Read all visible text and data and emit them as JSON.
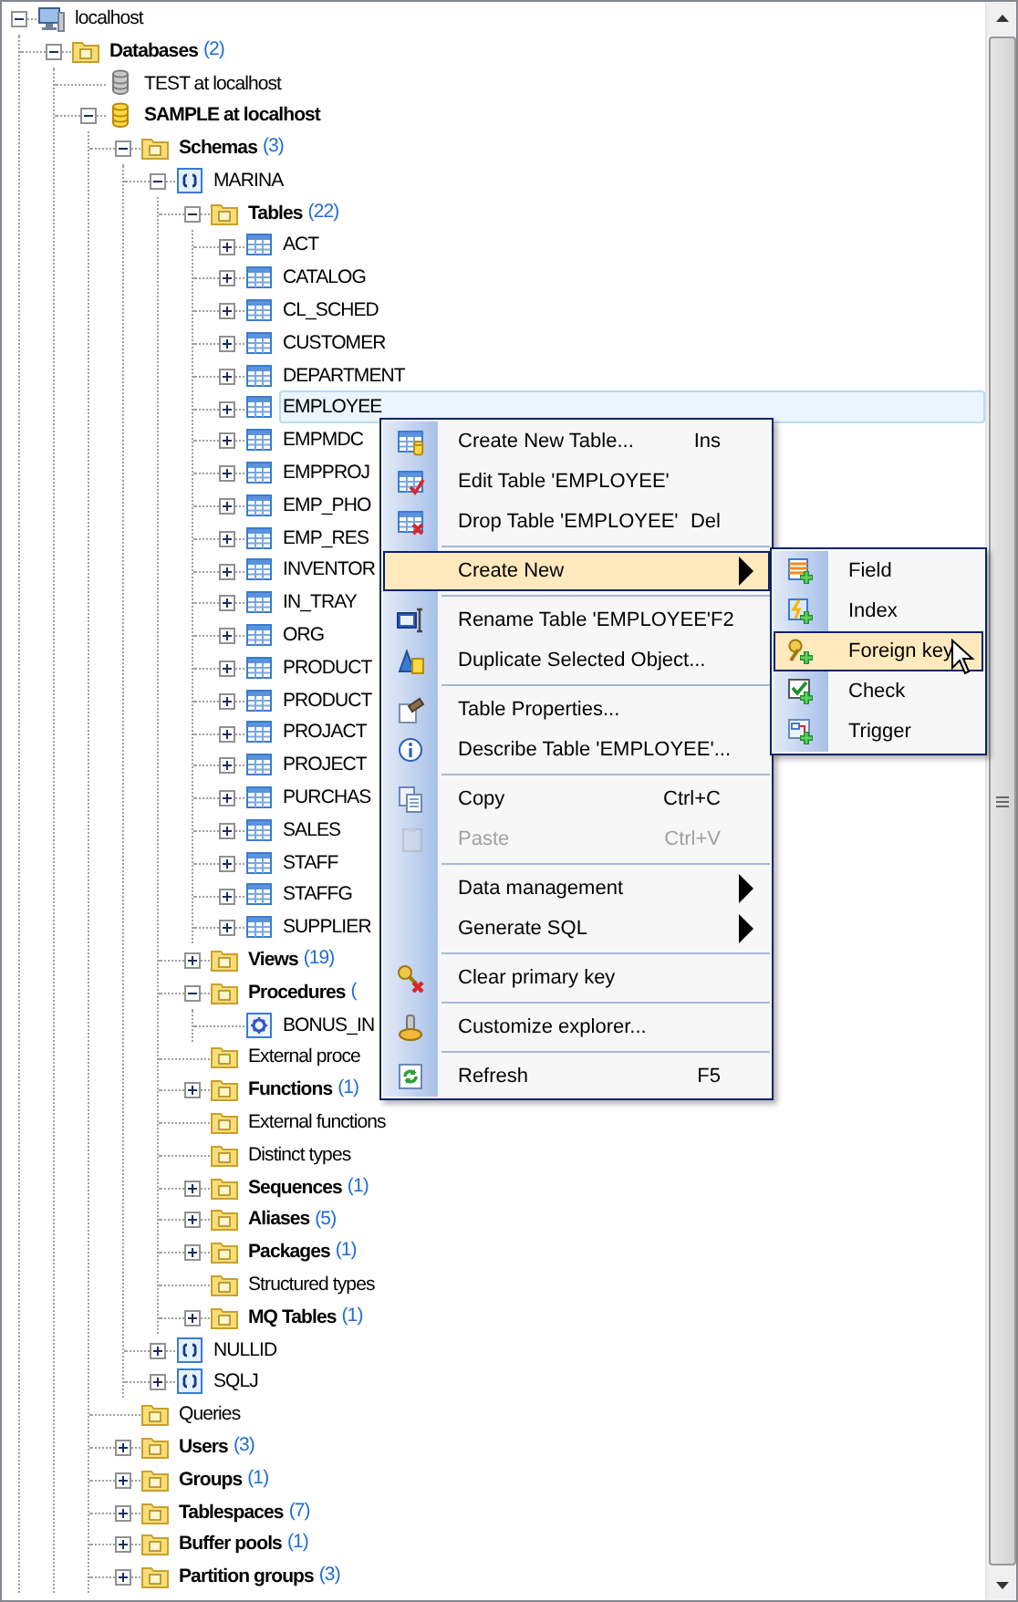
{
  "tree": [
    {
      "label": "localhost",
      "kind": "server",
      "bold": false,
      "expanded": true,
      "selected": false,
      "children": [
        {
          "label": "Databases",
          "count": "(2)",
          "kind": "folder",
          "bold": true,
          "expanded": true,
          "selected": false,
          "children": [
            {
              "label": "TEST at localhost",
              "kind": "database",
              "bold": false,
              "selected": false
            },
            {
              "label": "SAMPLE at localhost",
              "kind": "database",
              "bold": true,
              "expanded": true,
              "selected": false,
              "children": [
                {
                  "label": "Schemas",
                  "count": "(3)",
                  "kind": "folder",
                  "bold": true,
                  "expanded": true,
                  "selected": false,
                  "children": [
                    {
                      "label": "MARINA",
                      "kind": "schema",
                      "bold": false,
                      "expanded": true,
                      "selected": false,
                      "children": [
                        {
                          "label": "Tables",
                          "count": "(22)",
                          "kind": "folder",
                          "bold": true,
                          "expanded": true,
                          "selected": false,
                          "children": [
                            {
                              "label": "ACT",
                              "kind": "table",
                              "bold": false,
                              "expanded": false,
                              "selected": false
                            },
                            {
                              "label": "CATALOG",
                              "kind": "table",
                              "bold": false,
                              "expanded": false,
                              "selected": false
                            },
                            {
                              "label": "CL_SCHED",
                              "kind": "table",
                              "bold": false,
                              "expanded": false,
                              "selected": false
                            },
                            {
                              "label": "CUSTOMER",
                              "kind": "table",
                              "bold": false,
                              "expanded": false,
                              "selected": false
                            },
                            {
                              "label": "DEPARTMENT",
                              "kind": "table",
                              "bold": false,
                              "expanded": false,
                              "selected": false
                            },
                            {
                              "label": "EMPLOYEE",
                              "kind": "table",
                              "bold": false,
                              "expanded": false,
                              "selected": true
                            },
                            {
                              "label": "EMPMDC",
                              "kind": "table",
                              "bold": false,
                              "expanded": false,
                              "selected": false
                            },
                            {
                              "label": "EMPPROJ",
                              "kind": "table",
                              "bold": false,
                              "expanded": false,
                              "selected": false
                            },
                            {
                              "label": "EMP_PHO",
                              "kind": "table",
                              "bold": false,
                              "expanded": false,
                              "selected": false
                            },
                            {
                              "label": "EMP_RES",
                              "kind": "table",
                              "bold": false,
                              "expanded": false,
                              "selected": false
                            },
                            {
                              "label": "INVENTOR",
                              "kind": "table",
                              "bold": false,
                              "expanded": false,
                              "selected": false
                            },
                            {
                              "label": "IN_TRAY",
                              "kind": "table",
                              "bold": false,
                              "expanded": false,
                              "selected": false
                            },
                            {
                              "label": "ORG",
                              "kind": "table",
                              "bold": false,
                              "expanded": false,
                              "selected": false
                            },
                            {
                              "label": "PRODUCT",
                              "kind": "table",
                              "bold": false,
                              "expanded": false,
                              "selected": false
                            },
                            {
                              "label": "PRODUCT",
                              "kind": "table",
                              "bold": false,
                              "expanded": false,
                              "selected": false
                            },
                            {
                              "label": "PROJACT",
                              "kind": "table",
                              "bold": false,
                              "expanded": false,
                              "selected": false
                            },
                            {
                              "label": "PROJECT",
                              "kind": "table",
                              "bold": false,
                              "expanded": false,
                              "selected": false
                            },
                            {
                              "label": "PURCHAS",
                              "kind": "table",
                              "bold": false,
                              "expanded": false,
                              "selected": false
                            },
                            {
                              "label": "SALES",
                              "kind": "table",
                              "bold": false,
                              "expanded": false,
                              "selected": false
                            },
                            {
                              "label": "STAFF",
                              "kind": "table",
                              "bold": false,
                              "expanded": false,
                              "selected": false
                            },
                            {
                              "label": "STAFFG",
                              "kind": "table",
                              "bold": false,
                              "expanded": false,
                              "selected": false
                            },
                            {
                              "label": "SUPPLIER",
                              "kind": "table",
                              "bold": false,
                              "expanded": false,
                              "selected": false
                            }
                          ]
                        },
                        {
                          "label": "Views",
                          "count": "(19)",
                          "kind": "folder",
                          "bold": true,
                          "expanded": false,
                          "selected": false
                        },
                        {
                          "label": "Procedures",
                          "count": "(",
                          "kind": "folder",
                          "bold": true,
                          "expanded": true,
                          "selected": false,
                          "children": [
                            {
                              "label": "BONUS_IN",
                              "kind": "procedure",
                              "bold": false,
                              "selected": false
                            }
                          ]
                        },
                        {
                          "label": "External proce",
                          "kind": "folder",
                          "bold": false,
                          "selected": false
                        },
                        {
                          "label": "Functions",
                          "count": "(1)",
                          "kind": "folder",
                          "bold": true,
                          "expanded": false,
                          "selected": false
                        },
                        {
                          "label": "External functions",
                          "kind": "folder",
                          "bold": false,
                          "selected": false
                        },
                        {
                          "label": "Distinct types",
                          "kind": "folder",
                          "bold": false,
                          "selected": false
                        },
                        {
                          "label": "Sequences",
                          "count": "(1)",
                          "kind": "folder",
                          "bold": true,
                          "expanded": false,
                          "selected": false
                        },
                        {
                          "label": "Aliases",
                          "count": "(5)",
                          "kind": "folder",
                          "bold": true,
                          "expanded": false,
                          "selected": false
                        },
                        {
                          "label": "Packages",
                          "count": "(1)",
                          "kind": "folder",
                          "bold": true,
                          "expanded": false,
                          "selected": false
                        },
                        {
                          "label": "Structured types",
                          "kind": "folder",
                          "bold": false,
                          "selected": false
                        },
                        {
                          "label": "MQ Tables",
                          "count": "(1)",
                          "kind": "folder",
                          "bold": true,
                          "expanded": false,
                          "selected": false
                        }
                      ]
                    },
                    {
                      "label": "NULLID",
                      "kind": "schema",
                      "bold": false,
                      "expanded": false,
                      "selected": false
                    },
                    {
                      "label": "SQLJ",
                      "kind": "schema",
                      "bold": false,
                      "expanded": false,
                      "selected": false
                    }
                  ]
                },
                {
                  "label": "Queries",
                  "kind": "folder",
                  "bold": false,
                  "selected": false
                },
                {
                  "label": "Users",
                  "count": "(3)",
                  "kind": "folder",
                  "bold": true,
                  "expanded": false,
                  "selected": false
                },
                {
                  "label": "Groups",
                  "count": "(1)",
                  "kind": "folder",
                  "bold": true,
                  "expanded": false,
                  "selected": false
                },
                {
                  "label": "Tablespaces",
                  "count": "(7)",
                  "kind": "folder",
                  "bold": true,
                  "expanded": false,
                  "selected": false
                },
                {
                  "label": "Buffer pools",
                  "count": "(1)",
                  "kind": "folder",
                  "bold": true,
                  "expanded": false,
                  "selected": false
                },
                {
                  "label": "Partition groups",
                  "count": "(3)",
                  "kind": "folder",
                  "bold": true,
                  "expanded": false,
                  "selected": false
                }
              ]
            }
          ]
        }
      ]
    }
  ],
  "context_menu": {
    "items": [
      {
        "kind": "item",
        "label": "Create New Table...",
        "shortcut": "Ins",
        "disabled": false,
        "selected": false,
        "submenu": false
      },
      {
        "kind": "item",
        "label": "Edit Table 'EMPLOYEE'",
        "disabled": false,
        "selected": false,
        "submenu": false
      },
      {
        "kind": "item",
        "label": "Drop Table 'EMPLOYEE'",
        "shortcut": "Del",
        "disabled": false,
        "selected": false,
        "submenu": false
      },
      {
        "kind": "separator"
      },
      {
        "kind": "item",
        "label": "Create New",
        "disabled": false,
        "selected": true,
        "submenu": true
      },
      {
        "kind": "separator"
      },
      {
        "kind": "item",
        "label": "Rename Table 'EMPLOYEE'",
        "shortcut": "F2",
        "disabled": false,
        "selected": false,
        "submenu": false
      },
      {
        "kind": "item",
        "label": "Duplicate Selected Object...",
        "disabled": false,
        "selected": false,
        "submenu": false
      },
      {
        "kind": "separator"
      },
      {
        "kind": "item",
        "label": "Table Properties...",
        "disabled": false,
        "selected": false,
        "submenu": false
      },
      {
        "kind": "item",
        "label": "Describe Table 'EMPLOYEE'...",
        "disabled": false,
        "selected": false,
        "submenu": false
      },
      {
        "kind": "separator"
      },
      {
        "kind": "item",
        "label": "Copy",
        "shortcut": "Ctrl+C",
        "disabled": false,
        "selected": false,
        "submenu": false
      },
      {
        "kind": "item",
        "label": "Paste",
        "shortcut": "Ctrl+V",
        "disabled": true,
        "selected": false,
        "submenu": false
      },
      {
        "kind": "separator"
      },
      {
        "kind": "item",
        "label": "Data management",
        "disabled": false,
        "selected": false,
        "submenu": true
      },
      {
        "kind": "item",
        "label": "Generate SQL",
        "disabled": false,
        "selected": false,
        "submenu": true
      },
      {
        "kind": "separator"
      },
      {
        "kind": "item",
        "label": "Clear primary key",
        "disabled": false,
        "selected": false,
        "submenu": false
      },
      {
        "kind": "separator"
      },
      {
        "kind": "item",
        "label": "Customize explorer...",
        "disabled": false,
        "selected": false,
        "submenu": false
      },
      {
        "kind": "separator"
      },
      {
        "kind": "item",
        "label": "Refresh",
        "shortcut": "F5",
        "disabled": false,
        "selected": false,
        "submenu": false
      }
    ]
  },
  "submenu": {
    "items": [
      {
        "label": "Field",
        "selected": false
      },
      {
        "label": "Index",
        "selected": false
      },
      {
        "label": "Foreign key",
        "selected": true
      },
      {
        "label": "Check",
        "selected": false
      },
      {
        "label": "Trigger",
        "selected": false
      }
    ]
  }
}
